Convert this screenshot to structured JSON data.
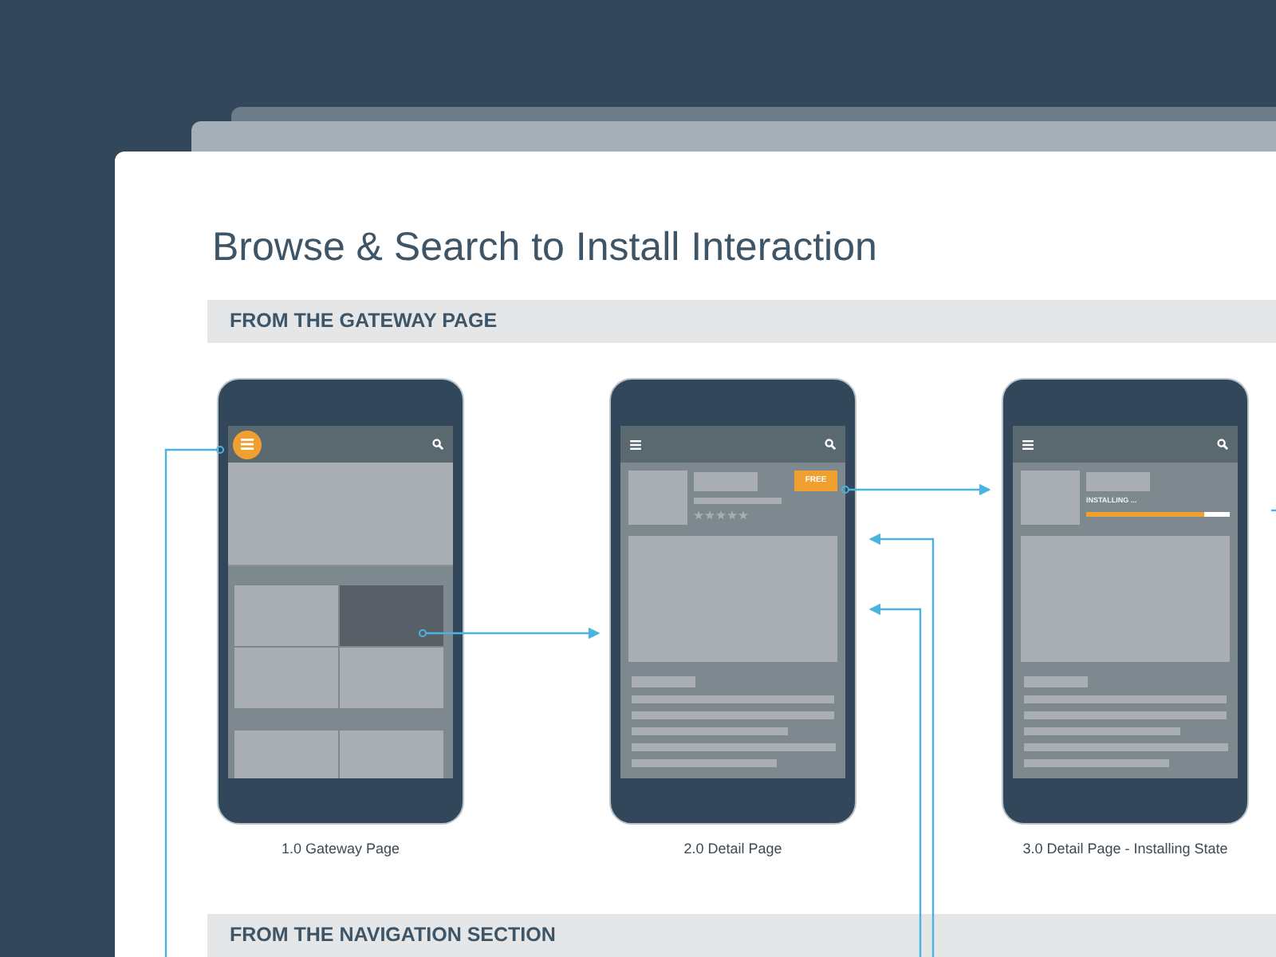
{
  "title": "Browse & Search to Install Interaction",
  "sections": [
    {
      "label": "FROM THE GATEWAY PAGE"
    },
    {
      "label": "FROM THE NAVIGATION SECTION"
    }
  ],
  "screens": [
    {
      "kind": "gateway",
      "caption": "1.0 Gateway Page",
      "menu_highlighted": true,
      "tiles": [
        {
          "selected": false
        },
        {
          "selected": true
        },
        {
          "selected": false
        },
        {
          "selected": false
        },
        {
          "selected": false
        },
        {
          "selected": false
        }
      ]
    },
    {
      "kind": "detail",
      "caption": "2.0 Detail Page",
      "menu_highlighted": false,
      "badge": "FREE",
      "stars": 0
    },
    {
      "kind": "installing",
      "caption": "3.0 Detail Page - Installing State",
      "menu_highlighted": false,
      "status": "INSTALLING ...",
      "level": 0.82
    }
  ]
}
